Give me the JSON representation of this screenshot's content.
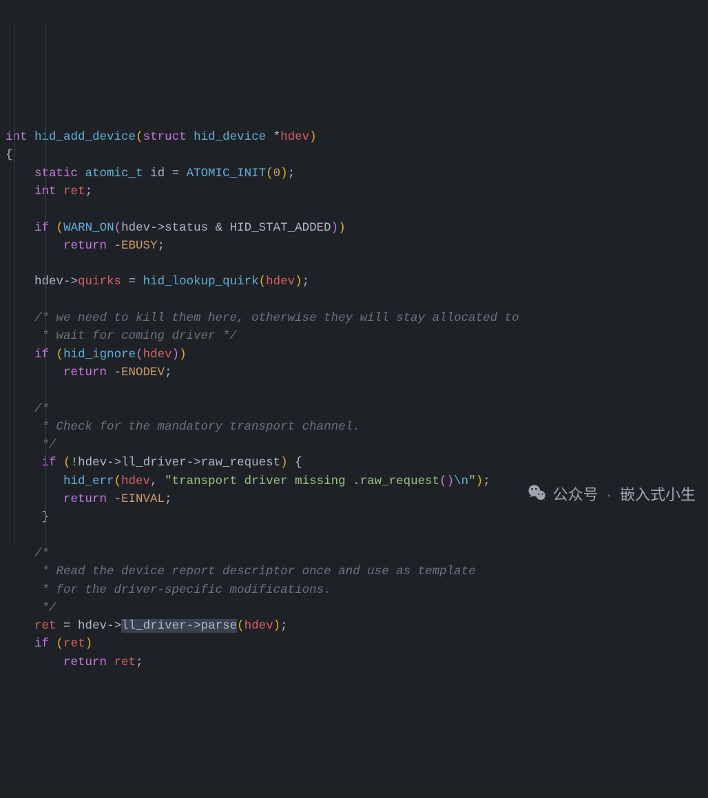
{
  "code": {
    "lines": [
      [
        {
          "t": "int",
          "c": "tok-type"
        },
        {
          "t": " ",
          "c": "tok-plain"
        },
        {
          "t": "hid_add_device",
          "c": "tok-func"
        },
        {
          "t": "(",
          "c": "tok-paren"
        },
        {
          "t": "struct",
          "c": "tok-kw"
        },
        {
          "t": " ",
          "c": "tok-plain"
        },
        {
          "t": "hid_device",
          "c": "tok-func"
        },
        {
          "t": " *",
          "c": "tok-plain"
        },
        {
          "t": "hdev",
          "c": "tok-ident"
        },
        {
          "t": ")",
          "c": "tok-paren"
        }
      ],
      [
        {
          "t": "{",
          "c": "tok-brace"
        }
      ],
      [
        {
          "t": "    ",
          "c": "tok-plain"
        },
        {
          "t": "static",
          "c": "tok-kw"
        },
        {
          "t": " ",
          "c": "tok-plain"
        },
        {
          "t": "atomic_t",
          "c": "tok-func"
        },
        {
          "t": " ",
          "c": "tok-plain"
        },
        {
          "t": "id",
          "c": "tok-plain"
        },
        {
          "t": " = ",
          "c": "tok-plain"
        },
        {
          "t": "ATOMIC_INIT",
          "c": "tok-func"
        },
        {
          "t": "(",
          "c": "tok-paren"
        },
        {
          "t": "0",
          "c": "tok-num"
        },
        {
          "t": ")",
          "c": "tok-paren"
        },
        {
          "t": ";",
          "c": "tok-plain"
        }
      ],
      [
        {
          "t": "    ",
          "c": "tok-plain"
        },
        {
          "t": "int",
          "c": "tok-type"
        },
        {
          "t": " ",
          "c": "tok-plain"
        },
        {
          "t": "ret",
          "c": "tok-ident"
        },
        {
          "t": ";",
          "c": "tok-plain"
        }
      ],
      [
        {
          "t": " ",
          "c": "tok-plain"
        }
      ],
      [
        {
          "t": "    ",
          "c": "tok-plain"
        },
        {
          "t": "if",
          "c": "tok-kw"
        },
        {
          "t": " ",
          "c": "tok-plain"
        },
        {
          "t": "(",
          "c": "tok-paren"
        },
        {
          "t": "WARN_ON",
          "c": "tok-func"
        },
        {
          "t": "(",
          "c": "tok-paren2"
        },
        {
          "t": "hdev",
          "c": "tok-plain"
        },
        {
          "t": "->",
          "c": "tok-plain"
        },
        {
          "t": "status",
          "c": "tok-plain"
        },
        {
          "t": " & HID_STAT_ADDED",
          "c": "tok-plain"
        },
        {
          "t": ")",
          "c": "tok-paren2"
        },
        {
          "t": ")",
          "c": "tok-paren"
        }
      ],
      [
        {
          "t": "        ",
          "c": "tok-plain"
        },
        {
          "t": "return",
          "c": "tok-kw"
        },
        {
          "t": " -",
          "c": "tok-plain"
        },
        {
          "t": "EBUSY",
          "c": "tok-const"
        },
        {
          "t": ";",
          "c": "tok-plain"
        }
      ],
      [
        {
          "t": " ",
          "c": "tok-plain"
        }
      ],
      [
        {
          "t": "    ",
          "c": "tok-plain"
        },
        {
          "t": "hdev",
          "c": "tok-plain"
        },
        {
          "t": "->",
          "c": "tok-plain"
        },
        {
          "t": "quirks",
          "c": "tok-ident"
        },
        {
          "t": " = ",
          "c": "tok-plain"
        },
        {
          "t": "hid_lookup_quirk",
          "c": "tok-func"
        },
        {
          "t": "(",
          "c": "tok-paren"
        },
        {
          "t": "hdev",
          "c": "tok-ident"
        },
        {
          "t": ")",
          "c": "tok-paren"
        },
        {
          "t": ";",
          "c": "tok-plain"
        }
      ],
      [
        {
          "t": " ",
          "c": "tok-plain"
        }
      ],
      [
        {
          "t": "    ",
          "c": "tok-plain"
        },
        {
          "t": "/* we need to kill them here, otherwise they will stay allocated to",
          "c": "tok-comment"
        }
      ],
      [
        {
          "t": "     * wait for coming driver */",
          "c": "tok-comment"
        }
      ],
      [
        {
          "t": "    ",
          "c": "tok-plain"
        },
        {
          "t": "if",
          "c": "tok-kw"
        },
        {
          "t": " ",
          "c": "tok-plain"
        },
        {
          "t": "(",
          "c": "tok-paren"
        },
        {
          "t": "hid_ignore",
          "c": "tok-func"
        },
        {
          "t": "(",
          "c": "tok-paren2"
        },
        {
          "t": "hdev",
          "c": "tok-ident"
        },
        {
          "t": ")",
          "c": "tok-paren2"
        },
        {
          "t": ")",
          "c": "tok-paren"
        }
      ],
      [
        {
          "t": "        ",
          "c": "tok-plain"
        },
        {
          "t": "return",
          "c": "tok-kw"
        },
        {
          "t": " -",
          "c": "tok-plain"
        },
        {
          "t": "ENODEV",
          "c": "tok-const"
        },
        {
          "t": ";",
          "c": "tok-plain"
        }
      ],
      [
        {
          "t": " ",
          "c": "tok-plain"
        }
      ],
      [
        {
          "t": "    ",
          "c": "tok-plain"
        },
        {
          "t": "/*",
          "c": "tok-comment"
        }
      ],
      [
        {
          "t": "     * Check for the mandatory transport channel.",
          "c": "tok-comment"
        }
      ],
      [
        {
          "t": "     */",
          "c": "tok-comment"
        }
      ],
      [
        {
          "t": "     ",
          "c": "tok-plain"
        },
        {
          "t": "if",
          "c": "tok-kw"
        },
        {
          "t": " ",
          "c": "tok-plain"
        },
        {
          "t": "(",
          "c": "tok-paren"
        },
        {
          "t": "!",
          "c": "tok-plain"
        },
        {
          "t": "hdev",
          "c": "tok-plain"
        },
        {
          "t": "->",
          "c": "tok-plain"
        },
        {
          "t": "ll_driver",
          "c": "tok-plain"
        },
        {
          "t": "->",
          "c": "tok-plain"
        },
        {
          "t": "raw_request",
          "c": "tok-plain"
        },
        {
          "t": ")",
          "c": "tok-paren"
        },
        {
          "t": " ",
          "c": "tok-plain"
        },
        {
          "t": "{",
          "c": "tok-brace"
        }
      ],
      [
        {
          "t": "        ",
          "c": "tok-plain"
        },
        {
          "t": "hid_err",
          "c": "tok-func"
        },
        {
          "t": "(",
          "c": "tok-paren"
        },
        {
          "t": "hdev",
          "c": "tok-ident"
        },
        {
          "t": ", ",
          "c": "tok-plain"
        },
        {
          "t": "\"transport driver missing .raw_request",
          "c": "tok-str"
        },
        {
          "t": "()",
          "c": "tok-paren2"
        },
        {
          "t": "\\n",
          "c": "tok-esc"
        },
        {
          "t": "\"",
          "c": "tok-str"
        },
        {
          "t": ")",
          "c": "tok-paren"
        },
        {
          "t": ";",
          "c": "tok-plain"
        }
      ],
      [
        {
          "t": "        ",
          "c": "tok-plain"
        },
        {
          "t": "return",
          "c": "tok-kw"
        },
        {
          "t": " -",
          "c": "tok-plain"
        },
        {
          "t": "EINVAL",
          "c": "tok-const"
        },
        {
          "t": ";",
          "c": "tok-plain"
        }
      ],
      [
        {
          "t": "     ",
          "c": "tok-plain"
        },
        {
          "t": "}",
          "c": "tok-brace"
        }
      ],
      [
        {
          "t": " ",
          "c": "tok-plain"
        }
      ],
      [
        {
          "t": "    ",
          "c": "tok-plain"
        },
        {
          "t": "/*",
          "c": "tok-comment"
        }
      ],
      [
        {
          "t": "     * Read the device report descriptor once and use as template",
          "c": "tok-comment"
        }
      ],
      [
        {
          "t": "     * for the driver-specific modifications.",
          "c": "tok-comment"
        }
      ],
      [
        {
          "t": "     */",
          "c": "tok-comment"
        }
      ],
      [
        {
          "t": "    ",
          "c": "tok-plain"
        },
        {
          "t": "ret",
          "c": "tok-ident"
        },
        {
          "t": " = ",
          "c": "tok-plain"
        },
        {
          "t": "hdev",
          "c": "tok-plain"
        },
        {
          "t": "->",
          "c": "tok-plain"
        },
        {
          "t": "ll_driver->parse",
          "c": "tok-hi"
        },
        {
          "t": "(",
          "c": "tok-paren"
        },
        {
          "t": "hdev",
          "c": "tok-ident"
        },
        {
          "t": ")",
          "c": "tok-paren"
        },
        {
          "t": ";",
          "c": "tok-plain"
        }
      ],
      [
        {
          "t": "    ",
          "c": "tok-plain"
        },
        {
          "t": "if",
          "c": "tok-kw"
        },
        {
          "t": " ",
          "c": "tok-plain"
        },
        {
          "t": "(",
          "c": "tok-paren"
        },
        {
          "t": "ret",
          "c": "tok-ident"
        },
        {
          "t": ")",
          "c": "tok-paren"
        }
      ],
      [
        {
          "t": "        ",
          "c": "tok-plain"
        },
        {
          "t": "return",
          "c": "tok-kw"
        },
        {
          "t": " ",
          "c": "tok-plain"
        },
        {
          "t": "ret",
          "c": "tok-ident"
        },
        {
          "t": ";",
          "c": "tok-plain"
        }
      ]
    ]
  },
  "watermark": {
    "left": "公众号",
    "right": "嵌入式小生"
  }
}
